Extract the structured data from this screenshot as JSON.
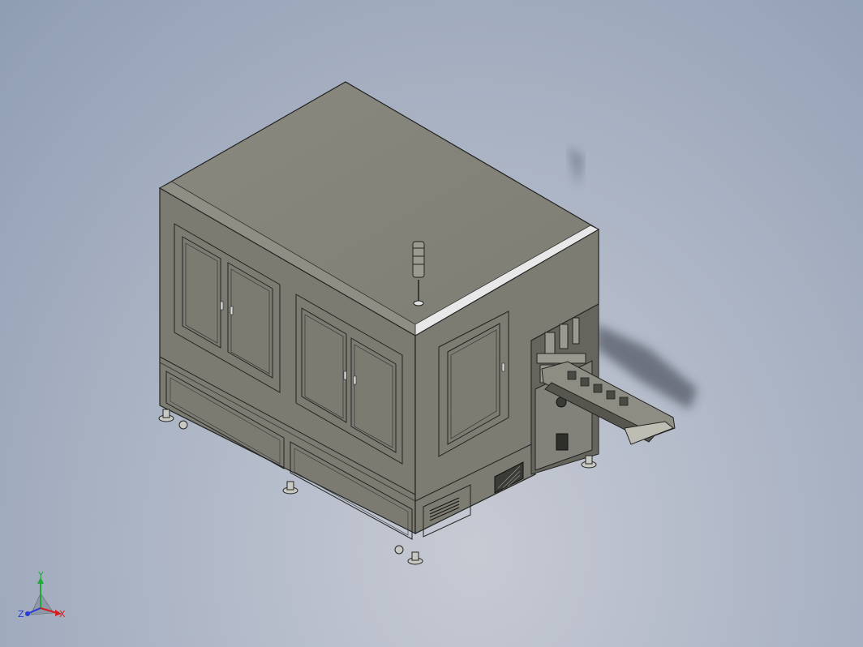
{
  "viewport": {
    "background_top": "#8f9db3",
    "background_bottom": "#c7cad3"
  },
  "model": {
    "body_color": "#7f7f76",
    "top_color": "#85847a",
    "edge_color": "#1e1e1e",
    "highlight_color": "#e6e6e6"
  },
  "triad": {
    "x_label": "X",
    "y_label": "Y",
    "z_label": "Z",
    "x_color": "#d42020",
    "y_color": "#1ea83a",
    "z_color": "#2a3ad6"
  }
}
